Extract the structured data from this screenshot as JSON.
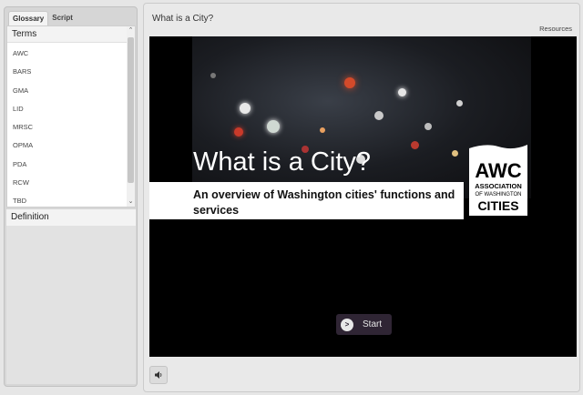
{
  "sidebar": {
    "tabs": [
      {
        "label": "Glossary",
        "active": true
      },
      {
        "label": "Script",
        "active": false
      }
    ],
    "terms_header": "Terms",
    "terms": [
      "AWC",
      "BARS",
      "GMA",
      "LID",
      "MRSC",
      "OPMA",
      "PDA",
      "RCW",
      "TBD"
    ],
    "definition_header": "Definition"
  },
  "main": {
    "title": "What is a City?",
    "resources_label": "Resources",
    "slide": {
      "title": "What is a City?",
      "subtitle": "An overview of Washington cities' functions and services",
      "logo": {
        "line1": "AWC",
        "line2": "ASSOCIATION",
        "line3": "OF WASHINGTON",
        "line4": "CITIES"
      },
      "start_label": "Start",
      "start_icon_glyph": ">"
    },
    "sound_icon": "speaker-icon"
  }
}
